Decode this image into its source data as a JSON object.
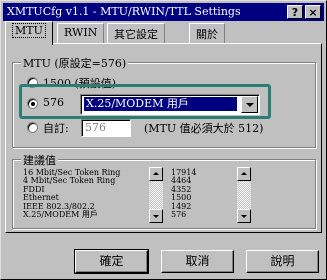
{
  "window": {
    "title": "XMTUCfg v1.1 - MTU/RWIN/TTL Settings",
    "help_glyph": "?",
    "close_glyph": "×"
  },
  "tabs": [
    {
      "label": "MTU",
      "active": true
    },
    {
      "label": "RWIN",
      "active": false
    },
    {
      "label": "其它設定",
      "active": false
    },
    {
      "label": "關於",
      "active": false
    }
  ],
  "mtu_group": {
    "label": "MTU (原設定=576)",
    "options": [
      {
        "label": "1500 (預設值)",
        "selected": false
      },
      {
        "label": "576",
        "selected": true
      },
      {
        "label": "自訂:",
        "selected": false
      }
    ],
    "combo_value": "X.25/MODEM 用戶",
    "custom_value": "576",
    "note": "(MTU 值必須大於 512)"
  },
  "recommend_group": {
    "label": "建議值",
    "names": [
      "16 Mbit/Sec Token Ring",
      "4 Mbit/Sec Token Ring",
      "FDDI",
      "Ethernet",
      "IEEE 802.3/802.2",
      "X.25/MODEM 用戶"
    ],
    "values": [
      "17914",
      "4464",
      "4352",
      "1500",
      "1492",
      "576"
    ]
  },
  "buttons": {
    "ok": "確定",
    "cancel": "取消",
    "help": "說明"
  }
}
